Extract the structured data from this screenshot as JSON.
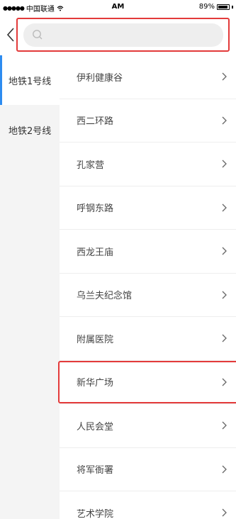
{
  "status_bar": {
    "carrier": "中国联通",
    "time": "AM",
    "battery": "89%"
  },
  "search": {
    "placeholder": ""
  },
  "sidebar": {
    "items": [
      {
        "label": "地铁1号线",
        "active": true
      },
      {
        "label": "地铁2号线",
        "active": false
      }
    ]
  },
  "stations": [
    "伊利健康谷",
    "西二环路",
    "孔家营",
    "呼钢东路",
    "西龙王庙",
    "乌兰夫纪念馆",
    "附属医院",
    "新华广场",
    "人民会堂",
    "将军衙署",
    "艺术学院"
  ],
  "colors": {
    "highlight": "#e33a3a",
    "active_indicator": "#2d8cf0"
  },
  "icons": {
    "back": "chevron-left-icon",
    "search": "search-icon",
    "row": "chevron-right-icon"
  }
}
